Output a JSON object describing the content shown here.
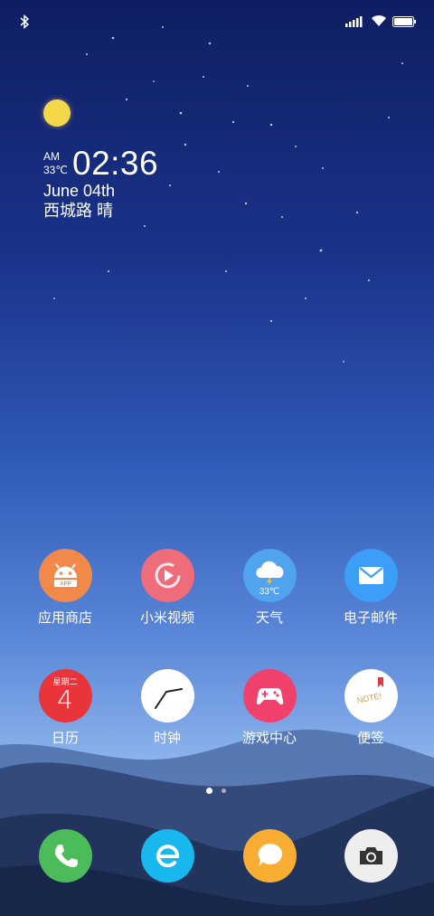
{
  "status_bar": {
    "icons": [
      "bluetooth-icon",
      "signal-icon",
      "wifi-icon",
      "battery-icon"
    ]
  },
  "clock_widget": {
    "ampm": "AM",
    "temperature": "33℃",
    "time": "02:36",
    "date": "June 04th",
    "location": "西城路 晴"
  },
  "apps": {
    "row1": [
      {
        "label": "应用商店",
        "icon": "app-store-icon",
        "color": "#f0894a"
      },
      {
        "label": "小米视频",
        "icon": "video-icon",
        "color": "#ef6c7a"
      },
      {
        "label": "天气",
        "icon": "weather-icon",
        "color": "#4fa3ef",
        "badge": "33℃"
      },
      {
        "label": "电子邮件",
        "icon": "email-icon",
        "color": "#3d9ef7"
      }
    ],
    "row2": [
      {
        "label": "日历",
        "icon": "calendar-icon",
        "color": "#e8343a",
        "weekday": "星期二",
        "day": "4"
      },
      {
        "label": "时钟",
        "icon": "clock-icon",
        "color": "#ffffff"
      },
      {
        "label": "游戏中心",
        "icon": "game-icon",
        "color": "#f0406c"
      },
      {
        "label": "便签",
        "icon": "notes-icon",
        "color": "#ffffff",
        "badge": "NOTE!"
      }
    ]
  },
  "page_indicator": {
    "pages": 2,
    "current": 1
  },
  "dock": [
    {
      "icon": "phone-icon",
      "color": "#4cbb5a"
    },
    {
      "icon": "browser-icon",
      "color": "#18b8ee"
    },
    {
      "icon": "message-icon",
      "color": "#f9ae33"
    },
    {
      "icon": "camera-icon",
      "color": "#eeeeee"
    }
  ]
}
